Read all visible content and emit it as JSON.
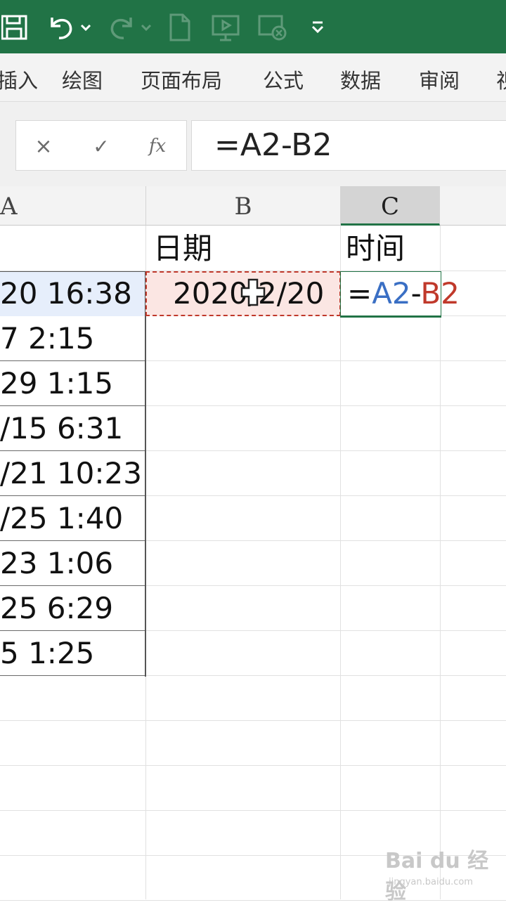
{
  "ribbon": {
    "tabs": [
      "插入",
      "绘图",
      "页面布局",
      "公式",
      "数据",
      "审阅",
      "视"
    ]
  },
  "formula_bar": {
    "cancel_symbol": "×",
    "enter_symbol": "✓",
    "fx_label": "fx",
    "formula": "=A2-B2"
  },
  "columns": [
    "A",
    "B",
    "C"
  ],
  "sheet": {
    "col_a_values": [
      "20 16:38",
      "7 2:15",
      "29 1:15",
      "/15 6:31",
      "/21 10:23",
      "/25 1:40",
      "23 1:06",
      "25 6:29",
      "5 1:25"
    ],
    "b1": "日期",
    "c1": "时间",
    "b2": "2020/2/20",
    "c2_parts": [
      "=",
      "A2",
      "-",
      "B2"
    ]
  },
  "colors": {
    "title_bar": "#217346",
    "ref_a": "#3a6fc4",
    "ref_b": "#c0392b"
  },
  "watermark": {
    "main": "Bai du 经验",
    "sub": "jingyan.baidu.com"
  }
}
